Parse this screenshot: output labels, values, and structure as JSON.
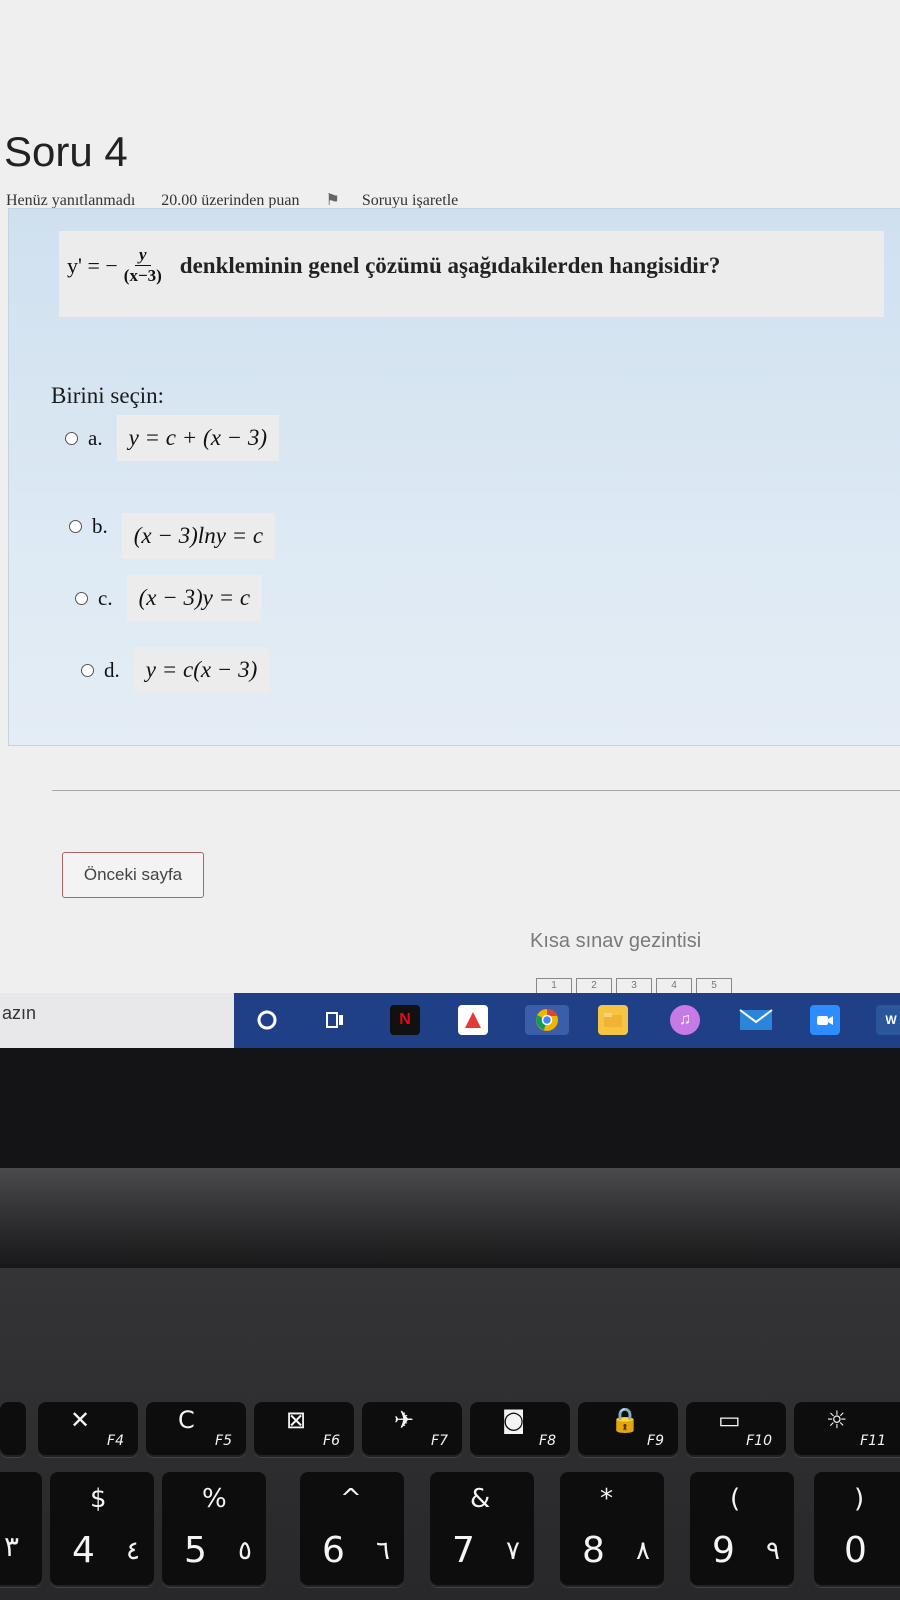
{
  "question": {
    "title": "Soru 4",
    "status": "Henüz yanıtlanmadı",
    "points": "20.00 üzerinden puan",
    "flag_label": "Soruyu işaretle",
    "stem_lhs": "y' = −",
    "stem_num": "y",
    "stem_den": "(x−3)",
    "stem_text": "denkleminin genel çözümü aşağıdakilerden hangisidir?",
    "choose_label": "Birini seçin:",
    "options": [
      {
        "letter": "a.",
        "text": "y = c + (x − 3)"
      },
      {
        "letter": "b.",
        "text": "(x − 3)lny = c"
      },
      {
        "letter": "c.",
        "text": "(x − 3)y = c"
      },
      {
        "letter": "d.",
        "text": "y = c(x − 3)"
      }
    ]
  },
  "navigation": {
    "prev_label": "Önceki sayfa",
    "heading": "Kısa sınav gezintisi",
    "pages": [
      "1",
      "2",
      "3",
      "4",
      "5"
    ]
  },
  "taskbar": {
    "search_fragment": "azın",
    "icons": [
      "cortana-icon",
      "task-view-icon",
      "netflix-icon",
      "app-a-icon",
      "chrome-icon",
      "file-explorer-icon",
      "itunes-icon",
      "mail-icon",
      "zoom-icon",
      "word-icon"
    ]
  },
  "keyboard": {
    "fkeys": [
      {
        "label": "F4",
        "symbol": "✕"
      },
      {
        "label": "F5",
        "symbol": "C"
      },
      {
        "label": "F6",
        "symbol": "⊠"
      },
      {
        "label": "F7",
        "symbol": "✈"
      },
      {
        "label": "F8",
        "symbol": "◙"
      },
      {
        "label": "F9",
        "symbol": "🔒"
      },
      {
        "label": "F10",
        "symbol": "▭"
      },
      {
        "label": "F11",
        "symbol": "☼"
      }
    ],
    "numkeys": [
      {
        "upper": "$",
        "lower": "4",
        "alt": "٤"
      },
      {
        "upper": "%",
        "lower": "5",
        "alt": "٥"
      },
      {
        "upper": "^",
        "lower": "6",
        "alt": "٦"
      },
      {
        "upper": "&",
        "lower": "7",
        "alt": "٧"
      },
      {
        "upper": "*",
        "lower": "8",
        "alt": "٨"
      },
      {
        "upper": "(",
        "lower": "9",
        "alt": "٩"
      },
      {
        "upper": ")",
        "lower": "0",
        "alt": ""
      }
    ]
  }
}
